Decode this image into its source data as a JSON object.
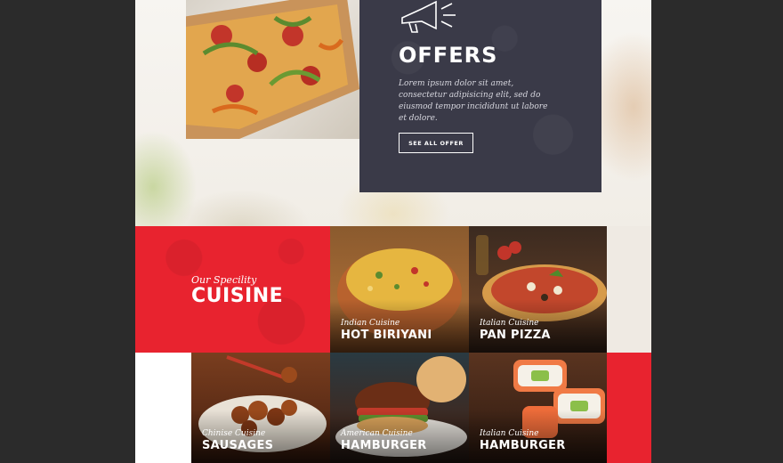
{
  "offers": {
    "title": "OFFERS",
    "text": "Lorem ipsum dolor sit amet, consectetur adipisicing elit, sed do eiusmod tempor incididunt ut labore et dolore.",
    "button_label": "SEE ALL OFFER",
    "icon": "megaphone-icon"
  },
  "cuisine": {
    "subtitle": "Our Specility",
    "title": "CUISINE",
    "tiles": [
      {
        "subtitle": "Indian Cuisine",
        "title": "HOT BIRIYANI"
      },
      {
        "subtitle": "Italian Cuisine",
        "title": "PAN PIZZA"
      },
      {
        "subtitle": "Chinise Cuisine",
        "title": "SAUSAGES"
      },
      {
        "subtitle": "American Cuisine",
        "title": "HAMBURGER"
      },
      {
        "subtitle": "Italian Cuisine",
        "title": "HAMBURGER"
      }
    ]
  },
  "colors": {
    "accent_red": "#e8232f",
    "card_dark": "#3a3a48",
    "frame_dark": "#2b2b2b"
  }
}
